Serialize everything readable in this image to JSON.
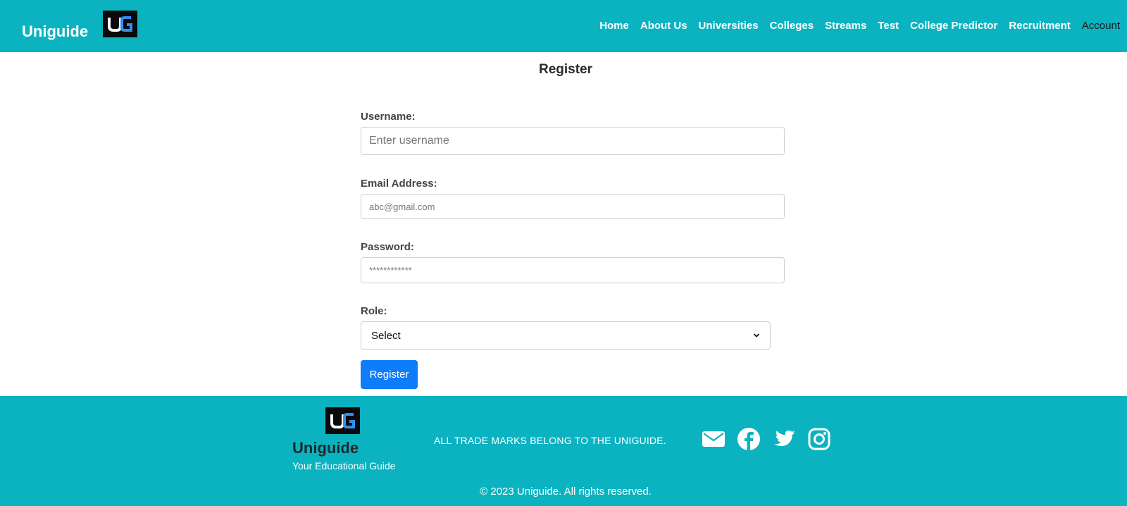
{
  "header": {
    "brand": "Uniguide",
    "logo_icon": "uniguide-logo-icon",
    "nav": [
      "Home",
      "About Us",
      "Universities",
      "Colleges",
      "Streams",
      "Test",
      "College Predictor",
      "Recruitment"
    ],
    "account_label": "Account"
  },
  "page": {
    "title": "Register"
  },
  "form": {
    "username_label": "Username:",
    "username_placeholder": "Enter username",
    "email_label": "Email Address:",
    "email_placeholder": "abc@gmail.com",
    "password_label": "Password:",
    "password_placeholder": "************",
    "role_label": "Role:",
    "role_selected": "Select",
    "register_label": "Register"
  },
  "footer": {
    "brand": "Uniguide",
    "tagline": "Your Educational Guide",
    "trademark": "ALL TRADE MARKS BELONG TO THE UNIGUIDE.",
    "social_icons": [
      "envelope-icon",
      "facebook-icon",
      "twitter-icon",
      "instagram-icon"
    ],
    "copyright": "© 2023 Uniguide. All rights reserved."
  },
  "colors": {
    "primary_teal": "#0bb3c1",
    "button_blue": "#0d7dfa",
    "logo_blue": "#2f8ff0"
  }
}
